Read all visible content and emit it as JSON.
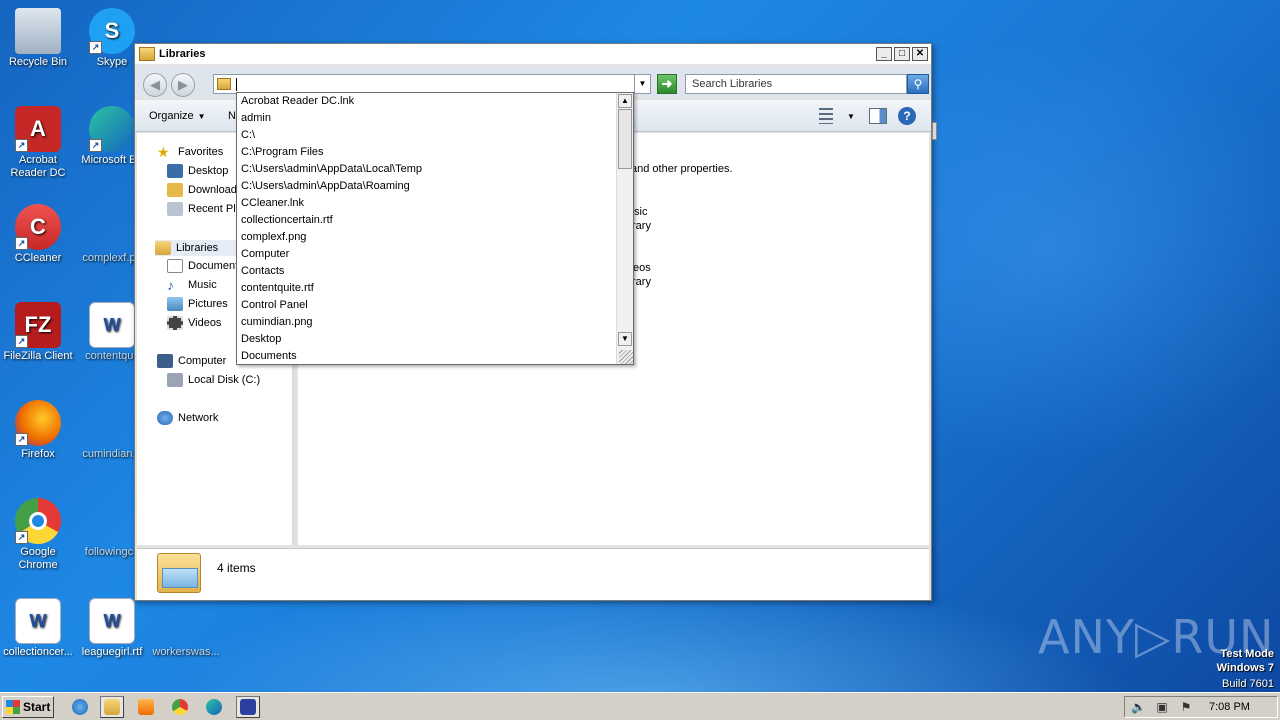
{
  "desktop": {
    "icons": [
      {
        "label": "Recycle Bin",
        "icon": "recycle-bin-icon"
      },
      {
        "label": "Skype",
        "icon": "skype-icon"
      },
      {
        "label": "Acrobat Reader DC",
        "icon": "acrobat-icon"
      },
      {
        "label": "Microsoft Ed",
        "icon": "edge-icon"
      },
      {
        "label": "CCleaner",
        "icon": "ccleaner-icon"
      },
      {
        "label": "complexf.pn",
        "icon": "image-file-icon"
      },
      {
        "label": "FileZilla Client",
        "icon": "filezilla-icon"
      },
      {
        "label": "contentquit",
        "icon": "word-doc-icon"
      },
      {
        "label": "Firefox",
        "icon": "firefox-icon"
      },
      {
        "label": "cumindian.p",
        "icon": "image-file-icon"
      },
      {
        "label": "Google Chrome",
        "icon": "chrome-icon"
      },
      {
        "label": "followingcn",
        "icon": "file-icon"
      },
      {
        "label": "collectioncer...",
        "icon": "word-doc-icon"
      },
      {
        "label": "leaguegirl.rtf",
        "icon": "word-doc-icon"
      },
      {
        "label": "workerswas...",
        "icon": "file-icon"
      }
    ],
    "watermark": "ANY▷RUN",
    "test_mode": {
      "line1": "Test Mode",
      "line2": "Windows 7",
      "line3": "Build 7601"
    }
  },
  "window": {
    "title": "Libraries",
    "address_value": "",
    "search_placeholder": "Search Libraries",
    "toolbar": {
      "organize": "Organize",
      "new_partial": "N"
    },
    "nav": {
      "favorites": "Favorites",
      "desktop": "Desktop",
      "downloads": "Downloads",
      "recent": "Recent Pla",
      "libraries": "Libraries",
      "documents": "Document",
      "music": "Music",
      "pictures": "Pictures",
      "videos": "Videos",
      "computer": "Computer",
      "local_disk": "Local Disk (C:)",
      "network": "Network"
    },
    "content_fragments": {
      "props": "and other properties.",
      "music_a": "sic",
      "music_b": "rary",
      "videos_a": "eos",
      "videos_b": "rary"
    },
    "status": {
      "count": "4 items"
    }
  },
  "address_dropdown": {
    "items": [
      "Acrobat Reader DC.lnk",
      "admin",
      "C:\\",
      "C:\\Program Files",
      "C:\\Users\\admin\\AppData\\Local\\Temp",
      "C:\\Users\\admin\\AppData\\Roaming",
      "CCleaner.lnk",
      "collectioncertain.rtf",
      "complexf.png",
      "Computer",
      "Contacts",
      "contentquite.rtf",
      "Control Panel",
      "cumindian.png",
      "Desktop",
      "Documents"
    ]
  },
  "taskbar": {
    "start": "Start",
    "clock": "7:08 PM"
  }
}
